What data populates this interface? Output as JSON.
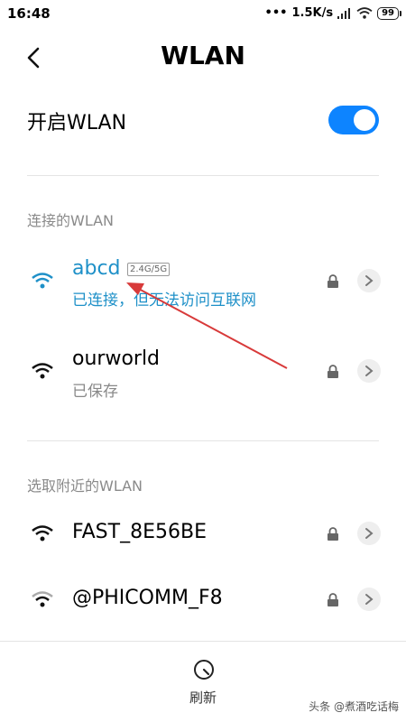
{
  "status_bar": {
    "time": "16:48",
    "speed": "1.5K/s",
    "battery": "99"
  },
  "header": {
    "title": "WLAN"
  },
  "toggle": {
    "label": "开启WLAN",
    "on": true
  },
  "connected_section": {
    "label": "连接的WLAN",
    "network": {
      "ssid": "abcd",
      "band": "2.4G/5G",
      "status": "已连接，但无法访问互联网"
    }
  },
  "saved_network": {
    "ssid": "ourworld",
    "status": "已保存"
  },
  "nearby_section": {
    "label": "选取附近的WLAN",
    "networks": [
      {
        "ssid": "FAST_8E56BE"
      },
      {
        "ssid": "@PHICOMM_F8"
      }
    ]
  },
  "bottom": {
    "refresh_label": "刷新"
  },
  "watermark": "头条 @煮酒吃话梅",
  "colors": {
    "accent": "#0d84ff",
    "connected": "#1e90c8",
    "arrow": "#d83a3a"
  }
}
